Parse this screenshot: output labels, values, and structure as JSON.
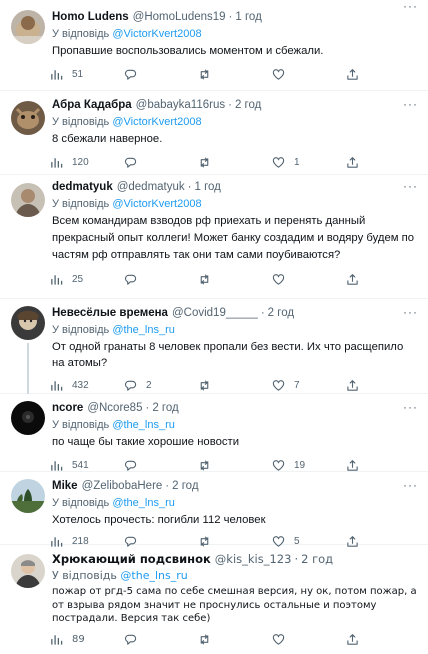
{
  "labels": {
    "reply_prefix": "У відповідь"
  },
  "tweets": [
    {
      "name": "Homo Ludens",
      "handle": "@HomoLudens19",
      "time": "1 год",
      "reply_to": "@VictorKvert2008",
      "text": "Пропавшие воспользовались моментом и сбежали.",
      "views": "51",
      "replies": "",
      "retweets": "",
      "likes": ""
    },
    {
      "name": "Абра Кадабра",
      "handle": "@babayka116rus",
      "time": "2 год",
      "reply_to": "@VictorKvert2008",
      "text": "8 сбежали наверное.",
      "views": "120",
      "replies": "",
      "retweets": "",
      "likes": "1"
    },
    {
      "name": "dedmatyuk",
      "handle": "@dedmatyuk",
      "time": "1 год",
      "reply_to": "@VictorKvert2008",
      "text": "Всем командирам взводов рф приехать и перенять данный прекрасный опыт коллеги! Может банку создадим и водяру будем по частям рф отправлять так они там сами поубиваются?",
      "views": "25",
      "replies": "",
      "retweets": "",
      "likes": ""
    },
    {
      "name": "Невесёлые времена",
      "handle": "@Covid19_____",
      "time": "2 год",
      "reply_to": "@the_lns_ru",
      "text": "От одной гранаты 8 человек  пропали без вести. Их что расщепило на атомы?",
      "views": "432",
      "replies": "2",
      "retweets": "",
      "likes": "7"
    },
    {
      "name": "ncore",
      "handle": "@Ncore85",
      "time": "2 год",
      "reply_to": "@the_lns_ru",
      "text": "по чаще бы такие хорошие новости",
      "views": "541",
      "replies": "",
      "retweets": "",
      "likes": "19"
    },
    {
      "name": "Mike",
      "handle": "@ZelibobaHere",
      "time": "2 год",
      "reply_to": "@the_lns_ru",
      "text": "Хотелось прочесть: погибли 112 человек",
      "views": "218",
      "replies": "",
      "retweets": "",
      "likes": "5"
    },
    {
      "name": "Хрюкающий подсвинок",
      "handle": "@kis_kis_123",
      "time": "2 год",
      "reply_to": "@the_lns_ru",
      "text": "пожар от ргд-5 сама по себе смешная версия, ну ок, потом пожар, а от взрыва рядом значит не проснулись остальные и поэтому пострадали. Версия так себе)",
      "views": "89",
      "replies": "",
      "retweets": "",
      "likes": ""
    }
  ]
}
